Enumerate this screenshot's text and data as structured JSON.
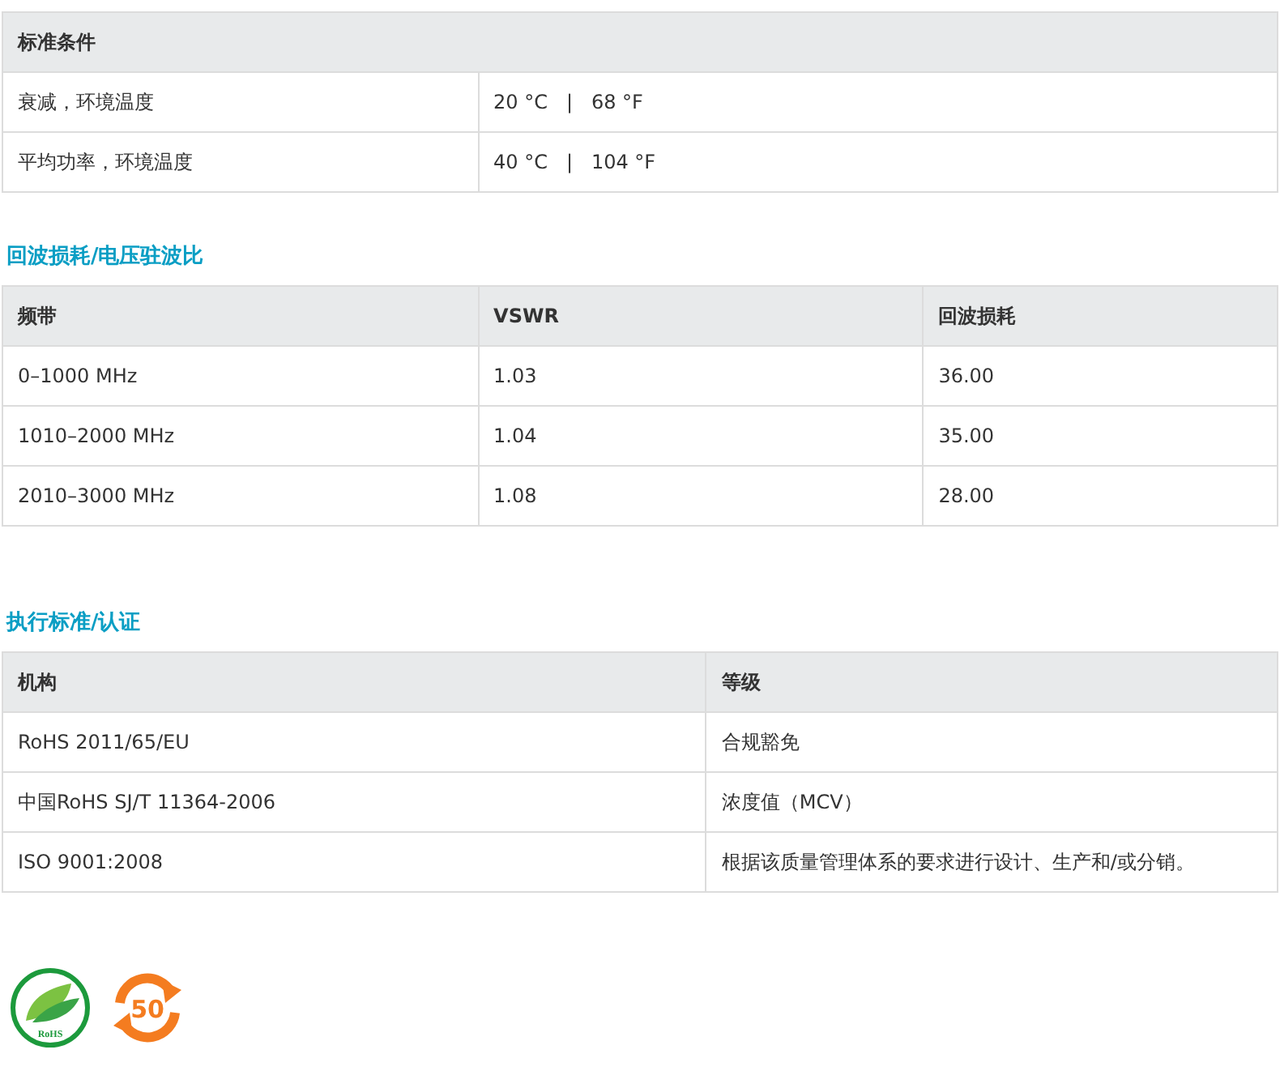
{
  "sections": [
    {
      "header": [
        "标准条件"
      ],
      "rows": [
        [
          "衰减，环境温度",
          "20 °C   |   68 °F"
        ],
        [
          "平均功率，环境温度",
          "40 °C   |   104 °F"
        ]
      ]
    },
    {
      "title": "回波损耗/电压驻波比",
      "header": [
        "频带",
        "VSWR",
        "回波损耗"
      ],
      "rows": [
        [
          "0–1000 MHz",
          "1.03",
          "36.00"
        ],
        [
          "1010–2000 MHz",
          "1.04",
          "35.00"
        ],
        [
          "2010–3000 MHz",
          "1.08",
          "28.00"
        ]
      ]
    },
    {
      "title": "执行标准/认证",
      "header": [
        "机构",
        "等级"
      ],
      "rows": [
        [
          "RoHS 2011/65/EU",
          "合规豁免"
        ],
        [
          "中国RoHS SJ/T 11364-2006",
          "浓度值（MCV）"
        ],
        [
          "ISO 9001:2008",
          "根据该质量管理体系的要求进行设计、生产和/或分销。"
        ]
      ]
    }
  ],
  "badges": [
    {
      "kind": "rohs",
      "text": "RoHS"
    },
    {
      "kind": "efup",
      "text": "50"
    }
  ]
}
